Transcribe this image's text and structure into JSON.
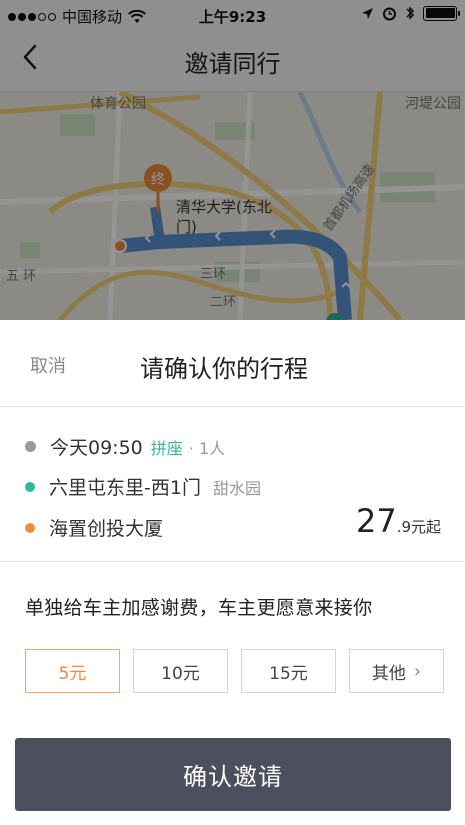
{
  "status_bar": {
    "carrier": "中国移动",
    "time": "上午9:23"
  },
  "nav": {
    "title": "邀请同行"
  },
  "map": {
    "labels": {
      "park_left": "体育公园",
      "park_right": "河堤公园",
      "expressway": "首都机场高速",
      "ring_top": "三环",
      "ring_bottom": "二环",
      "fifth_ring": "五\n环",
      "destination_marker": "终",
      "destination_name_line1": "清华大学(东北",
      "destination_name_line2": "门)"
    },
    "colors": {
      "route": "#5b8fd1",
      "marker": "#f08a3c"
    }
  },
  "sheet": {
    "cancel": "取消",
    "title": "请确认你的行程"
  },
  "trip": {
    "time": "今天09:50",
    "ride_type": "拼座",
    "passengers": "· 1人",
    "origin": "六里屯东里-西1门",
    "origin_area": "甜水园",
    "destination": "海置创投大厦",
    "price_integer": "27",
    "price_suffix": ".9元起",
    "colors": {
      "origin_dot": "#33b59a",
      "destination_dot": "#f08a3c"
    }
  },
  "tip": {
    "text": "单独给车主加感谢费，车主更愿意来接你",
    "options": [
      "5元",
      "10元",
      "15元",
      "其他"
    ],
    "selected_index": 0
  },
  "confirm": {
    "label": "确认邀请"
  }
}
